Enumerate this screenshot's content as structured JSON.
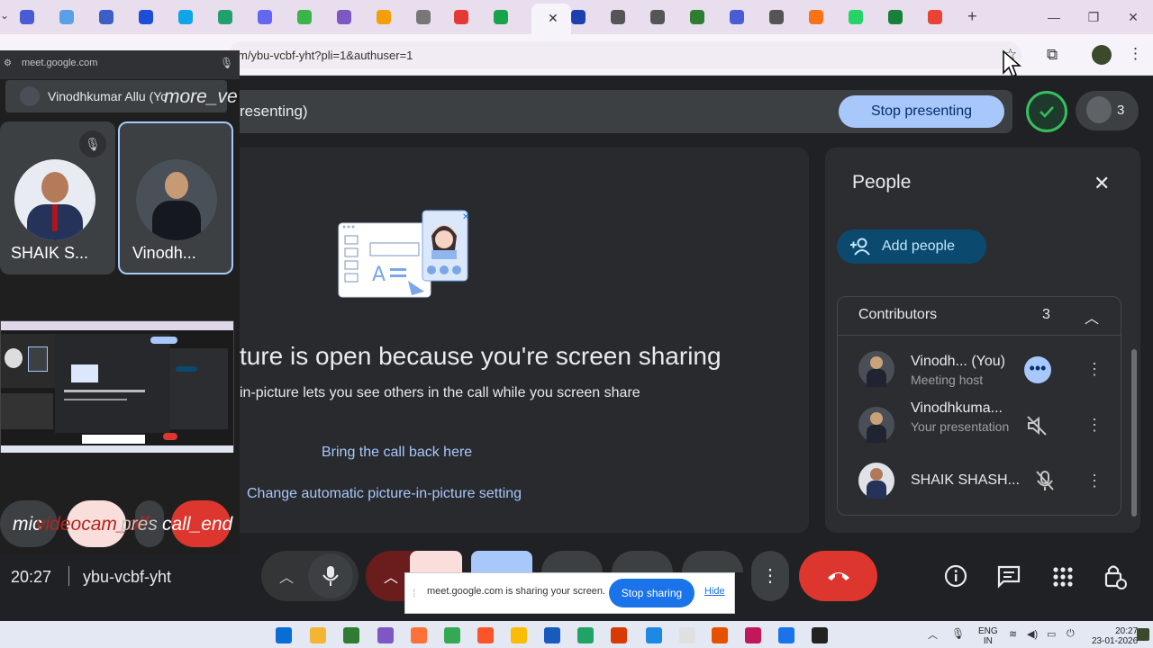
{
  "browser": {
    "url": "m/ybu-vcbf-yht?pli=1&authuser=1",
    "tab_colors": [
      "#4a5bd6",
      "#5aa0e8",
      "#3b5fc5",
      "#1d4ed8",
      "#0ea5e9",
      "#22a06b",
      "#6366f1",
      "#39b54a",
      "#7e57c2",
      "#f59e0b",
      "#777777",
      "#e53935",
      "#16a34a",
      "#1e40af",
      "#555555",
      "#555555",
      "#2e7d32",
      "#4a5bd6",
      "#555555",
      "#f97316",
      "#25d366",
      "#188038",
      "#ea4335"
    ]
  },
  "meet": {
    "presenting_title": "resenting)",
    "stop_presenting_label": "Stop presenting",
    "participant_count": "3",
    "pip_headline": "ture is open because you're screen sharing",
    "pip_subtext": "in-picture lets you see others in the call while you screen share",
    "bring_back_label": "Bring the call back here",
    "change_pip_label": "Change automatic picture-in-picture setting",
    "clock": "20:27",
    "meeting_code": "ybu-vcbf-yht"
  },
  "people_panel": {
    "title": "People",
    "add_people_label": "Add people",
    "contributors_label": "Contributors",
    "contributors_count": "3",
    "participants": [
      {
        "name": "Vinodh... (You)",
        "sub": "Meeting host"
      },
      {
        "name": "Vinodhkuma...",
        "sub": "Your presentation"
      },
      {
        "name": "SHAIK SHASH...",
        "sub": ""
      }
    ]
  },
  "pip": {
    "origin": "meet.google.com",
    "presenter_name": "Vinodhkumar Allu (Yo",
    "more_label": "more_ve",
    "tiles": [
      {
        "name": "SHAIK S..."
      },
      {
        "name": "Vinodh..."
      }
    ],
    "controls": {
      "mic_label": "mic",
      "videocam_label": "videocam_off",
      "present_label": "pres",
      "call_end_label": "call_end"
    }
  },
  "share_notice": {
    "text": "meet.google.com is sharing your screen.",
    "stop_label": "Stop sharing",
    "hide_label": "Hide"
  },
  "taskbar": {
    "lang_line1": "ENG",
    "lang_line2": "IN",
    "time": "20:27",
    "date": "23-01-2026"
  },
  "colors": {
    "accent": "#a8c7fa",
    "end_call": "#dc362e",
    "add_people_bg": "#0b4a6e"
  }
}
